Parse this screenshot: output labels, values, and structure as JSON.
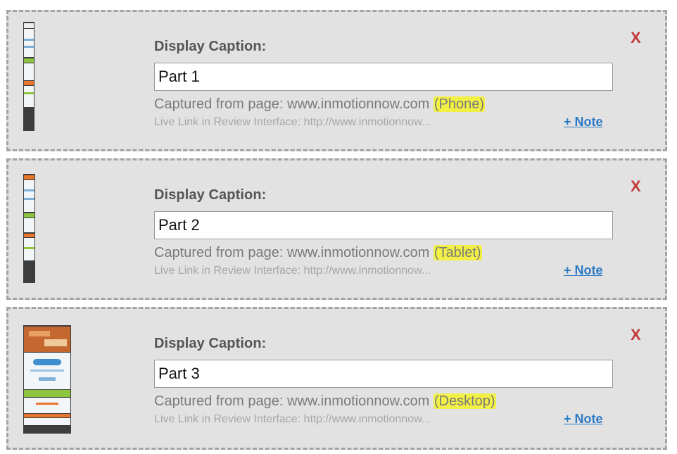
{
  "captures": [
    {
      "caption_label": "Display Caption:",
      "caption_value": "Part 1",
      "captured_prefix": "Captured from page: www.inmotionnow.com ",
      "device": "(Phone)",
      "live_link": "Live Link in Review Interface: http://www.inmotionnow...",
      "note_label": "+ Note",
      "remove_label": "X",
      "thumbnail_icon": "phone-page-thumbnail"
    },
    {
      "caption_label": "Display Caption:",
      "caption_value": "Part 2",
      "captured_prefix": "Captured from page: www.inmotionnow.com ",
      "device": "(Tablet)",
      "live_link": "Live Link in Review Interface: http://www.inmotionnow...",
      "note_label": "+ Note",
      "remove_label": "X",
      "thumbnail_icon": "tablet-page-thumbnail"
    },
    {
      "caption_label": "Display Caption:",
      "caption_value": "Part 3",
      "captured_prefix": "Captured from page: www.inmotionnow.com ",
      "device": "(Desktop)",
      "live_link": "Live Link in Review Interface: http://www.inmotionnow...",
      "note_label": "+ Note",
      "remove_label": "X",
      "thumbnail_icon": "desktop-page-thumbnail"
    }
  ],
  "colors": {
    "card_background": "#e2e2e2",
    "card_border": "#a3a3a3",
    "device_highlight": "#f3f045",
    "note_link": "#2e7ac5",
    "remove_x": "#c43a3a"
  }
}
